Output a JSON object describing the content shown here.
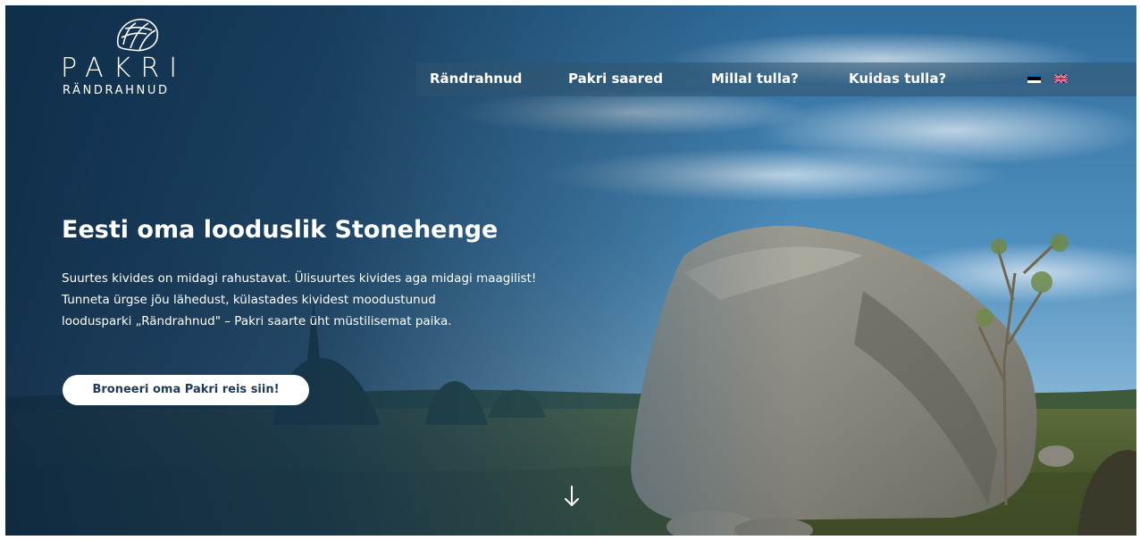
{
  "brand": {
    "name": "PAKRI",
    "subtitle": "RÄNDRAHNUD",
    "logo_icon": "boulders-logo-icon"
  },
  "nav": {
    "items": [
      {
        "label": "Rändrahnud"
      },
      {
        "label": "Pakri saared"
      },
      {
        "label": "Millal tulla?"
      },
      {
        "label": "Kuidas tulla?"
      }
    ],
    "languages": [
      {
        "code": "et",
        "icon": "estonian-flag-icon"
      },
      {
        "code": "en",
        "icon": "uk-flag-icon"
      }
    ]
  },
  "hero": {
    "title": "Eesti oma looduslik Stonehenge",
    "lines": [
      "Suurtes kivides on midagi rahustavat. Ülisuurtes kivides aga midagi maagilist!",
      "Tunneta ürgse jõu lähedust, külastades kividest moodustunud",
      "loodusparki „Rändrahnud\" – Pakri saarte üht müstilisemat paika."
    ],
    "cta_label": "Broneeri oma Pakri reis siin!",
    "scroll_icon": "arrow-down-icon"
  },
  "colors": {
    "overlay": "#0c2842",
    "nav_bar": "#32546e",
    "cta_text": "#1f3b57"
  }
}
